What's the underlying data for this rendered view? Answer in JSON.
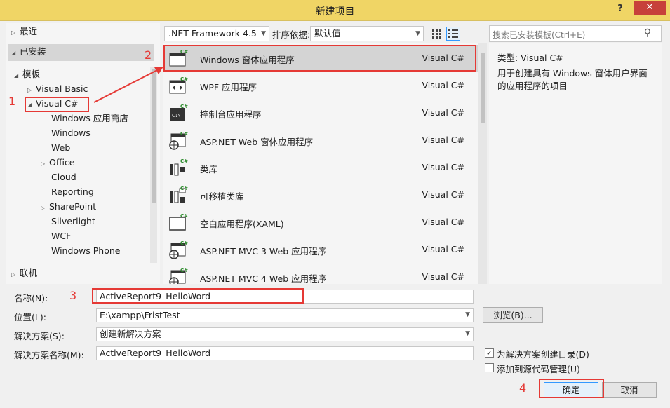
{
  "window": {
    "title": "新建项目",
    "help": "?",
    "close": "✕"
  },
  "tree": {
    "recent": "最近",
    "installed": "已安装",
    "templates": "模板",
    "visual_basic": "Visual Basic",
    "visual_csharp": "Visual C#",
    "children": [
      "Windows 应用商店",
      "Windows",
      "Web",
      "Office",
      "Cloud",
      "Reporting",
      "SharePoint",
      "Silverlight",
      "WCF",
      "Windows Phone"
    ],
    "online": "联机"
  },
  "toolbar": {
    "framework": ".NET Framework 4.5",
    "sort_label": "排序依据:",
    "sort_value": "默认值"
  },
  "search": {
    "placeholder": "搜索已安装模板(Ctrl+E)"
  },
  "templates": [
    {
      "name": "Windows 窗体应用程序",
      "lang": "Visual C#",
      "icon": "winforms-icon"
    },
    {
      "name": "WPF 应用程序",
      "lang": "Visual C#",
      "icon": "wpf-icon"
    },
    {
      "name": "控制台应用程序",
      "lang": "Visual C#",
      "icon": "console-icon"
    },
    {
      "name": "ASP.NET Web 窗体应用程序",
      "lang": "Visual C#",
      "icon": "web-icon"
    },
    {
      "name": "类库",
      "lang": "Visual C#",
      "icon": "library-icon"
    },
    {
      "name": "可移植类库",
      "lang": "Visual C#",
      "icon": "portable-library-icon"
    },
    {
      "name": "空白应用程序(XAML)",
      "lang": "Visual C#",
      "icon": "blank-app-icon"
    },
    {
      "name": "ASP.NET MVC 3 Web 应用程序",
      "lang": "Visual C#",
      "icon": "web-icon"
    },
    {
      "name": "ASP.NET MVC 4 Web 应用程序",
      "lang": "Visual C#",
      "icon": "web-icon"
    }
  ],
  "description": {
    "type": "类型:  Visual C#",
    "text": "用于创建具有 Windows 窗体用户界面的应用程序的项目"
  },
  "form": {
    "name_label": "名称(N):",
    "name_value": "ActiveReport9_HelloWord",
    "location_label": "位置(L):",
    "location_value": "E:\\xampp\\FristTest",
    "solution_label": "解决方案(S):",
    "solution_value": "创建新解决方案",
    "solution_name_label": "解决方案名称(M):",
    "solution_name_value": "ActiveReport9_HelloWord",
    "browse": "浏览(B)...",
    "create_dir_label": "为解决方案创建目录(D)",
    "source_control_label": "添加到源代码管理(U)",
    "ok": "确定",
    "cancel": "取消"
  },
  "annotations": {
    "n1": "1",
    "n2": "2",
    "n3": "3",
    "n4": "4"
  },
  "colors": {
    "accent_red": "#e53935",
    "title_bar": "#f0d565",
    "close": "#c7413a",
    "selection": "#d4d4d4"
  }
}
